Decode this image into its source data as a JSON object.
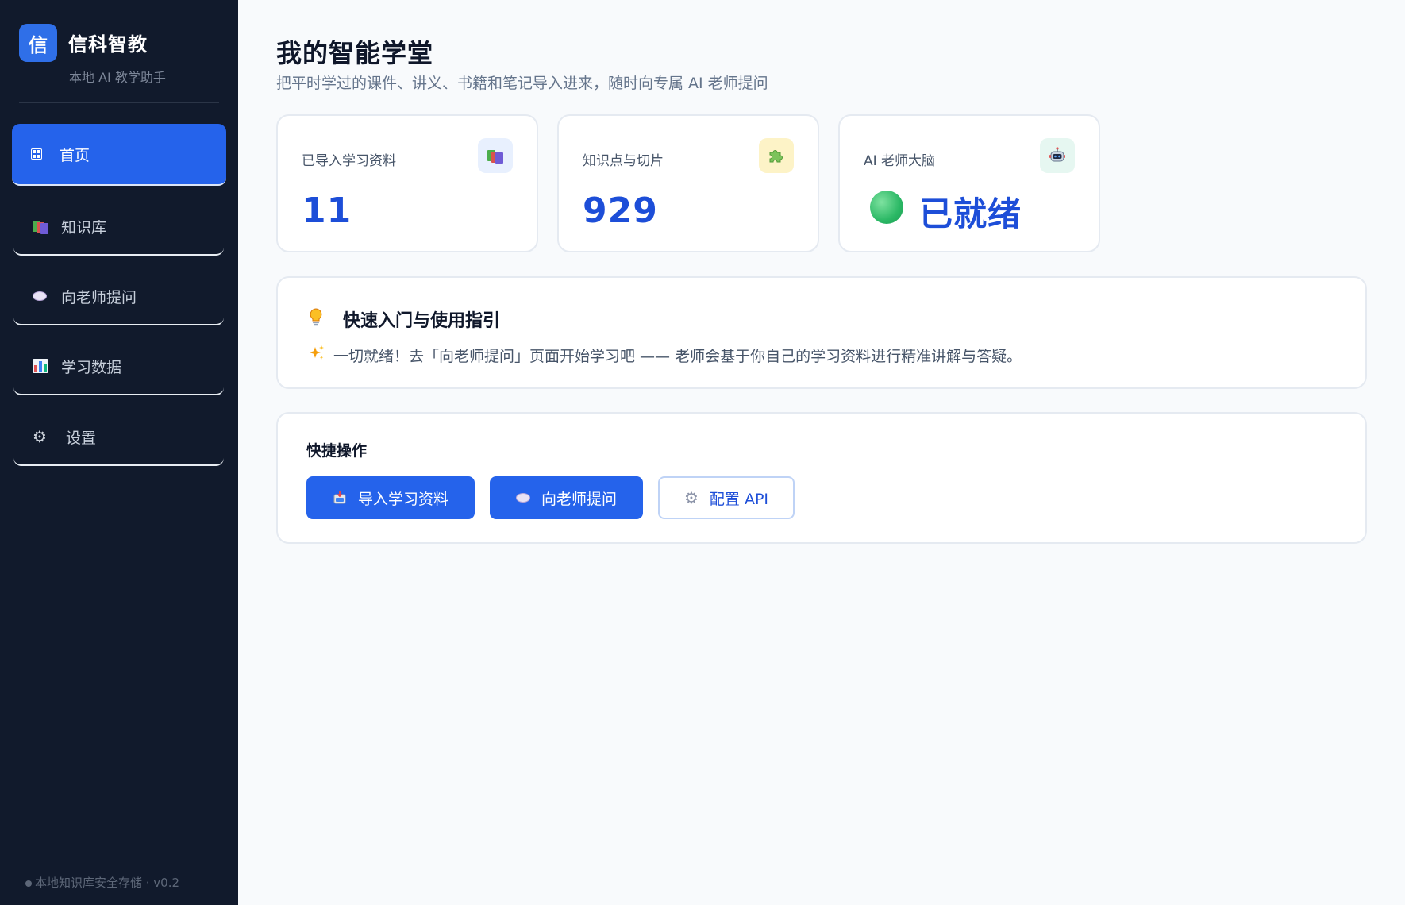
{
  "sidebar": {
    "logo_char": "信",
    "app_name": "信科智教",
    "app_subtitle": "本地 AI 教学助手",
    "items": [
      {
        "label": "首页",
        "icon": "home-grid-icon",
        "active": true
      },
      {
        "label": "知识库",
        "icon": "books-icon",
        "active": false
      },
      {
        "label": "向老师提问",
        "icon": "speech-bubble-icon",
        "active": false
      },
      {
        "label": "学习数据",
        "icon": "bar-chart-icon",
        "active": false
      },
      {
        "label": "设置",
        "icon": "gear-icon",
        "active": false
      }
    ],
    "footer": "本地知识库安全存储 · v0.2"
  },
  "header": {
    "title": "我的智能学堂",
    "subtitle": "把平时学过的课件、讲义、书籍和笔记导入进来，随时向专属 AI 老师提问"
  },
  "stats": [
    {
      "label": "已导入学习资料",
      "value": "11",
      "icon": "books-icon"
    },
    {
      "label": "知识点与切片",
      "value": "929",
      "icon": "puzzle-icon"
    },
    {
      "label": "AI 老师大脑",
      "value": "已就绪",
      "icon": "robot-icon",
      "status_color": "#2bb865"
    }
  ],
  "guide": {
    "title": "快速入门与使用指引",
    "text": "一切就绪！去「向老师提问」页面开始学习吧 —— 老师会基于你自己的学习资料进行精准讲解与答疑。"
  },
  "quick": {
    "title": "快捷操作",
    "buttons": [
      {
        "label": "导入学习资料",
        "icon": "inbox-icon"
      },
      {
        "label": "向老师提问",
        "icon": "speech-bubble-icon"
      },
      {
        "label": "配置 API",
        "icon": "gear-icon"
      }
    ]
  },
  "colors": {
    "accent": "#2563eb",
    "sidebar_bg": "#111a2c",
    "page_bg": "#f8fafc"
  }
}
